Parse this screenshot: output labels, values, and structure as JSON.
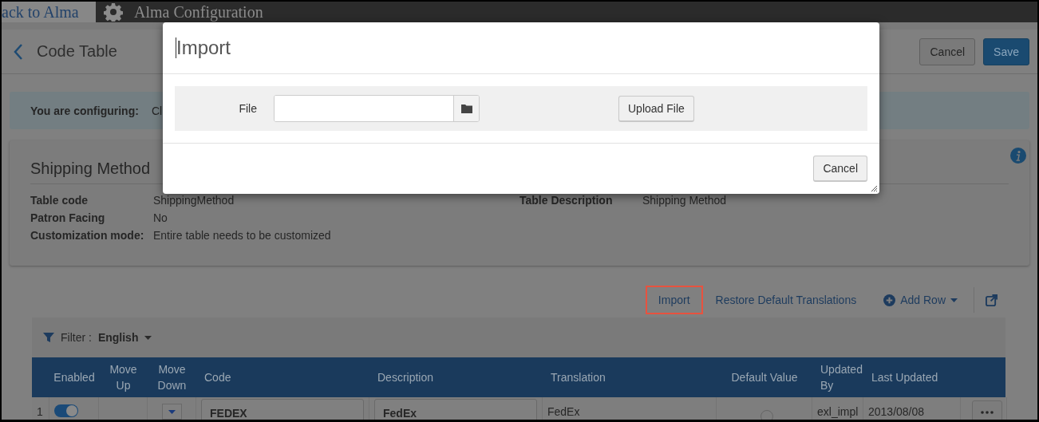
{
  "top_bar": {
    "back_link": "ack to Alma",
    "section": "Alma Configuration"
  },
  "page": {
    "title": "Code Table",
    "buttons": [
      {
        "label": "Cancel",
        "kind": "secondary"
      },
      {
        "label": "Save",
        "kind": "primary"
      }
    ]
  },
  "banner": {
    "label": "You are configuring:",
    "value": "Cl"
  },
  "details": {
    "title": "Shipping Method",
    "left_fields": [
      {
        "label": "Table code",
        "value": "ShippingMethod"
      },
      {
        "label": "Patron Facing",
        "value": "No"
      },
      {
        "label": "Customization mode:",
        "value": "Entire table needs to be customized"
      }
    ],
    "right_fields": [
      {
        "label": "Table Description",
        "value": "Shipping Method"
      }
    ]
  },
  "toolbar": {
    "actions": [
      {
        "label": "Import",
        "highlighted": true
      },
      {
        "label": "Restore Default Translations",
        "highlighted": false
      }
    ],
    "add_row": "Add Row"
  },
  "filter": {
    "label": "Filter :",
    "value": "English"
  },
  "table": {
    "columns": [
      "Enabled",
      "Move Up",
      "Move Down",
      "Code",
      "Description",
      "Translation",
      "Default Value",
      "Updated By",
      "Last Updated"
    ],
    "rows": [
      {
        "number": "1",
        "enabled": true,
        "code": "FEDEX",
        "description": "FedEx",
        "translation": "FedEx",
        "default": false,
        "updated_by": "exl_impl",
        "last_updated": "2013/08/08"
      }
    ]
  },
  "dialog": {
    "title": "Import",
    "file_label": "File",
    "upload_button": "Upload File",
    "cancel_button": "Cancel"
  }
}
